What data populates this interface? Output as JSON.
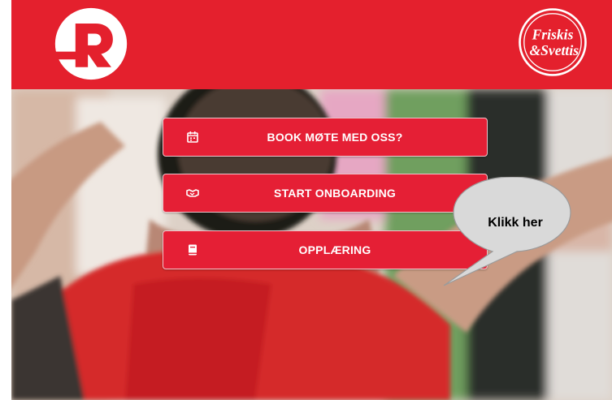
{
  "header": {
    "brand_logo_icon": "r-logo",
    "partner_logo_icon": "friskis-svettis-logo",
    "partner_logo_text": "Friskis&Svettis",
    "color": "#e4202d"
  },
  "menu": {
    "items": [
      {
        "label": "BOOK MØTE MED OSS?",
        "icon": "calendar-icon"
      },
      {
        "label": "START ONBOARDING",
        "icon": "handshake-icon"
      },
      {
        "label": "OPPLÆRING",
        "icon": "book-icon"
      }
    ],
    "color": "#e51f35"
  },
  "callout": {
    "text": "Klikk her"
  }
}
